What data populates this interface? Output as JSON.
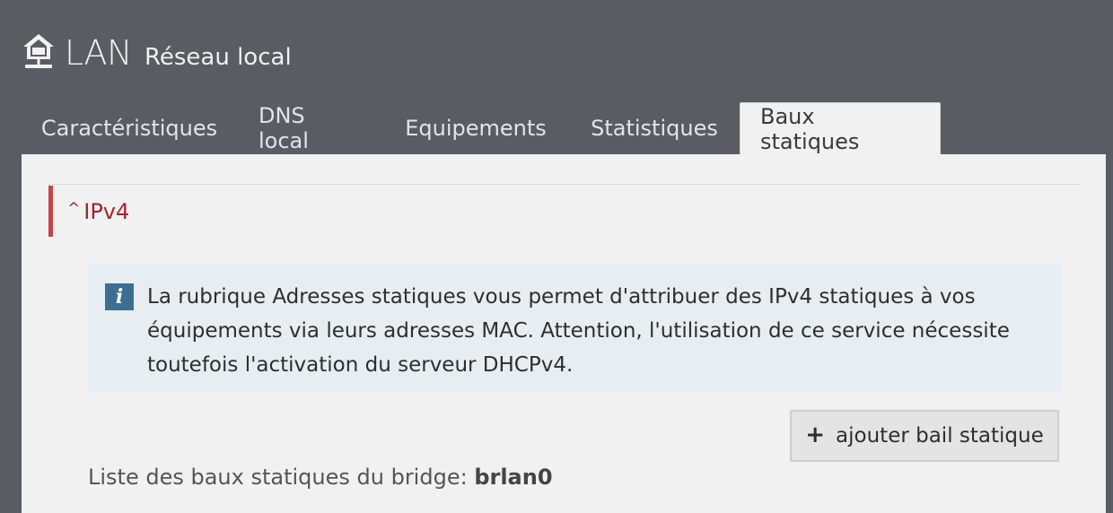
{
  "header": {
    "icon": "home-router-icon",
    "title": "LAN",
    "subtitle": "Réseau local"
  },
  "tabs": [
    {
      "label": "Caractéristiques",
      "active": false
    },
    {
      "label": "DNS local",
      "active": false
    },
    {
      "label": "Equipements",
      "active": false
    },
    {
      "label": "Statistiques",
      "active": false
    },
    {
      "label": "Baux statiques",
      "active": true
    }
  ],
  "section": {
    "label": "IPv4",
    "expanded": true,
    "accent_color": "#c7424f"
  },
  "info": {
    "icon": "info-icon",
    "text": "La rubrique Adresses statiques vous permet d'attribuer des IPv4 statiques à vos équipements via leurs adresses MAC. Attention, l'utilisation de ce service nécessite toutefois l'activation du serveur DHCPv4."
  },
  "add_button": {
    "icon": "plus-icon",
    "label": "ajouter bail statique"
  },
  "list": {
    "label": "Liste des baux statiques du bridge:",
    "bridge": "brlan0"
  }
}
